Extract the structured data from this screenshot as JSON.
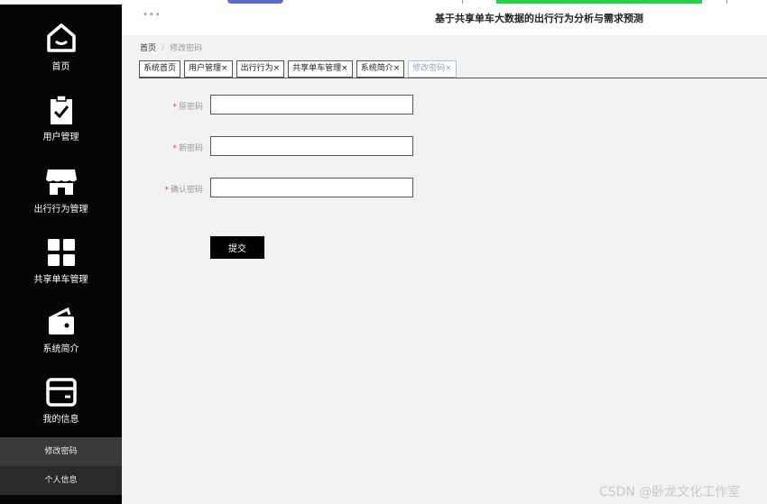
{
  "header": {
    "title": "基于共享单车大数据的出行行为分析与需求预测",
    "dots": "•••"
  },
  "sidebar": {
    "items": [
      {
        "label": "首页",
        "icon": "home-icon"
      },
      {
        "label": "用户管理",
        "icon": "clipboard-check-icon"
      },
      {
        "label": "出行行为管理",
        "icon": "store-icon"
      },
      {
        "label": "共享单车管理",
        "icon": "grid-icon"
      },
      {
        "label": "系统简介",
        "icon": "wallet-icon"
      },
      {
        "label": "我的信息",
        "icon": "card-icon"
      }
    ],
    "sub_items": [
      "修改密码",
      "个人信息"
    ]
  },
  "breadcrumb": {
    "home": "首页",
    "sep": "/",
    "current": "修改密码"
  },
  "tabs": [
    {
      "label": "系统首页",
      "close": ""
    },
    {
      "label": "用户管理",
      "close": "×"
    },
    {
      "label": "出行行为",
      "close": "×"
    },
    {
      "label": "共享单车管理",
      "close": "×"
    },
    {
      "label": "系统简介",
      "close": "×"
    },
    {
      "label": "修改密码",
      "close": "×"
    }
  ],
  "form": {
    "fields": [
      {
        "label": "原密码",
        "required": "*",
        "value": ""
      },
      {
        "label": "新密码",
        "required": "*",
        "value": ""
      },
      {
        "label": "确认密码",
        "required": "*",
        "value": ""
      }
    ],
    "submit_label": "提交"
  },
  "watermark": "CSDN @卧龙文化工作室"
}
